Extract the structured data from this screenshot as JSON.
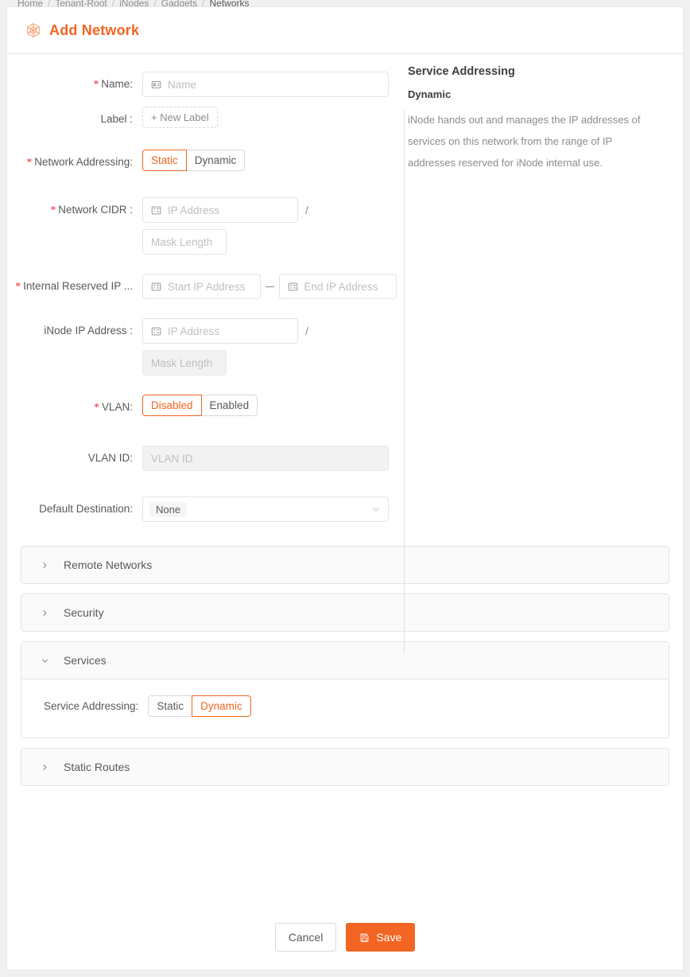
{
  "breadcrumb": {
    "items": [
      "Home",
      "Tenant-Root",
      "iNodes",
      "Gadgets",
      "Networks"
    ],
    "separator": "/"
  },
  "header": {
    "title": "Add Network",
    "icon": "hexagon-network-icon",
    "accent_color": "#f26522"
  },
  "form": {
    "fields": {
      "name": {
        "label": "Name:",
        "required": true,
        "placeholder": "Name",
        "value": "",
        "icon": "id-card-icon"
      },
      "label": {
        "label": "Label :",
        "required": false,
        "button": "+ New Label"
      },
      "network_addressing": {
        "label": "Network Addressing:",
        "required": true,
        "options": [
          "Static",
          "Dynamic"
        ],
        "selected": "Static"
      },
      "network_cidr": {
        "label": "Network CIDR :",
        "required": true,
        "ip_placeholder": "IP Address",
        "ip_value": "",
        "separator": "/",
        "mask_placeholder": "Mask Length",
        "mask_value": "",
        "mask_disabled": false,
        "icon": "ip-address-icon"
      },
      "internal_reserved_ip": {
        "label": "Internal Reserved IP ...",
        "required": true,
        "start_placeholder": "Start IP Address",
        "start_value": "",
        "end_placeholder": "End IP Address",
        "end_value": "",
        "range_separator": "–",
        "icon": "ip-address-icon"
      },
      "inode_ip_address": {
        "label": "iNode IP Address :",
        "required": false,
        "ip_placeholder": "IP Address",
        "ip_value": "",
        "separator": "/",
        "mask_placeholder": "Mask Length",
        "mask_value": "",
        "mask_disabled": true,
        "icon": "ip-address-icon"
      },
      "vlan": {
        "label": "VLAN:",
        "required": true,
        "options": [
          "Disabled",
          "Enabled"
        ],
        "selected": "Disabled"
      },
      "vlan_id": {
        "label": "VLAN ID:",
        "required": false,
        "placeholder": "VLAN ID",
        "value": "",
        "disabled": true
      },
      "default_destination": {
        "label": "Default Destination:",
        "required": false,
        "selected": "None",
        "caret": "chevron-down-icon"
      }
    }
  },
  "info_panel": {
    "title": "Service Addressing",
    "subtitle": "Dynamic",
    "description": "iNode hands out and manages the IP addresses of services on this network from the range of IP addresses reserved for iNode internal use."
  },
  "panels": [
    {
      "title": "Remote Networks",
      "expanded": false,
      "arrow": "chevron-right-icon"
    },
    {
      "title": "Security",
      "expanded": false,
      "arrow": "chevron-right-icon"
    },
    {
      "title": "Services",
      "expanded": true,
      "arrow": "chevron-down-icon"
    },
    {
      "title": "Static Routes",
      "expanded": false,
      "arrow": "chevron-right-icon"
    }
  ],
  "services_panel": {
    "service_addressing": {
      "label": "Service Addressing:",
      "options": [
        "Static",
        "Dynamic"
      ],
      "selected": "Dynamic"
    }
  },
  "footer": {
    "cancel_label": "Cancel",
    "save_label": "Save",
    "save_icon": "save-disk-icon"
  }
}
